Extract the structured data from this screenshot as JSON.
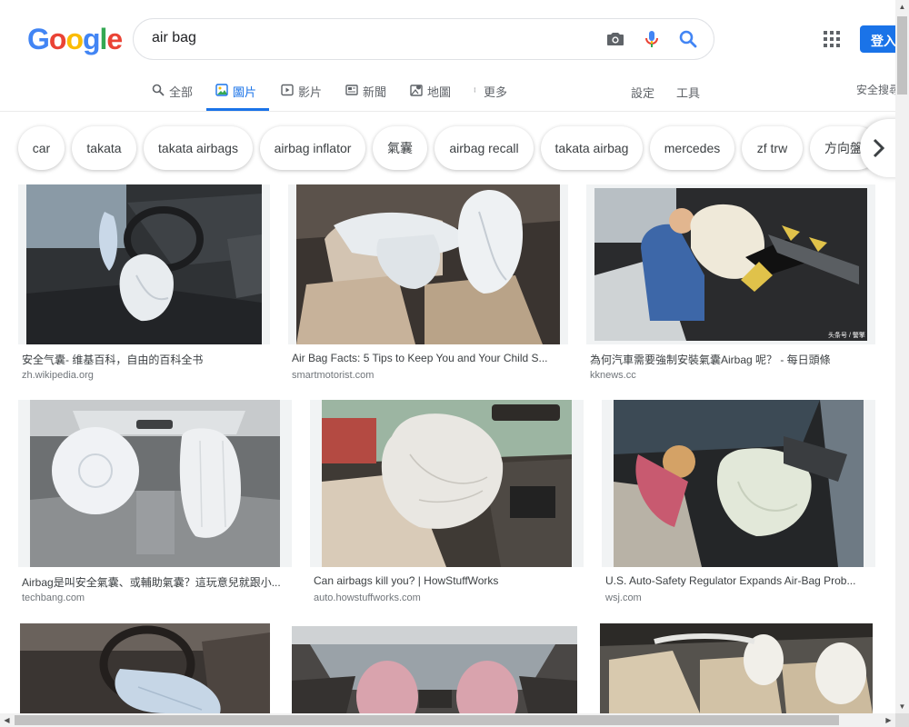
{
  "header": {
    "logo": [
      "G",
      "o",
      "o",
      "g",
      "l",
      "e"
    ],
    "logo_colors": [
      "#4285f4",
      "#ea4335",
      "#fbbc05",
      "#4285f4",
      "#34a853",
      "#ea4335"
    ],
    "search_query": "air bag",
    "signin_label": "登入"
  },
  "tabs": {
    "all": "全部",
    "images": "圖片",
    "videos": "影片",
    "news": "新聞",
    "maps": "地圖",
    "more": "更多",
    "settings": "設定",
    "tools": "工具",
    "safesearch": "安全搜尋"
  },
  "chips": [
    "car",
    "takata",
    "takata airbags",
    "airbag inflator",
    "氣囊",
    "airbag recall",
    "takata airbag",
    "mercedes",
    "zf trw",
    "方向盤"
  ],
  "results": [
    {
      "title": "安全气囊- 维基百科，自由的百科全书",
      "source": "zh.wikipedia.org",
      "watermark": ""
    },
    {
      "title": "Air Bag Facts: 5 Tips to Keep You and Your Child S...",
      "source": "smartmotorist.com",
      "watermark": ""
    },
    {
      "title": "為何汽車需要強制安裝氣囊Airbag 呢？ - 每日頭條",
      "source": "kknews.cc",
      "watermark": "头条号 / 警擎"
    },
    {
      "title": "Airbag是叫安全氣囊、或輔助氣囊？這玩意兒就跟小...",
      "source": "techbang.com",
      "watermark": ""
    },
    {
      "title": "Can airbags kill you? | HowStuffWorks",
      "source": "auto.howstuffworks.com",
      "watermark": ""
    },
    {
      "title": "U.S. Auto-Safety Regulator Expands Air-Bag Prob...",
      "source": "wsj.com",
      "watermark": ""
    },
    {
      "title": "",
      "source": "",
      "watermark": ""
    },
    {
      "title": "",
      "source": "",
      "watermark": ""
    },
    {
      "title": "",
      "source": "",
      "watermark": ""
    }
  ],
  "colors": {
    "accent": "#1a73e8",
    "airbag": "#e8ecef",
    "pink_airbag": "#d9a3ad"
  }
}
